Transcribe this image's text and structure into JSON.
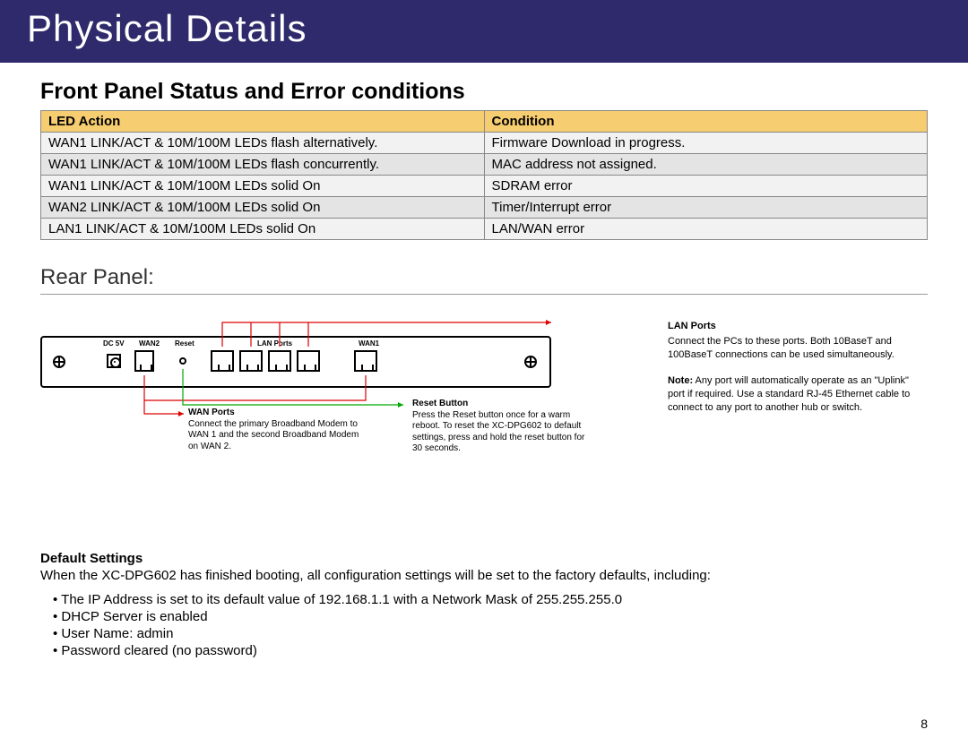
{
  "header": {
    "title": "Physical Details"
  },
  "section1": {
    "title": "Front Panel Status and Error conditions",
    "headers": [
      "LED Action",
      "Condition"
    ],
    "rows": [
      [
        "WAN1 LINK/ACT & 10M/100M LEDs flash alternatively.",
        "Firmware Download in progress."
      ],
      [
        "WAN1 LINK/ACT & 10M/100M LEDs flash concurrently.",
        "MAC address not assigned."
      ],
      [
        "WAN1 LINK/ACT & 10M/100M LEDs solid On",
        "SDRAM error"
      ],
      [
        "WAN2 LINK/ACT & 10M/100M LEDs solid On",
        "Timer/Interrupt error"
      ],
      [
        "LAN1 LINK/ACT & 10M/100M LEDs solid On",
        "LAN/WAN error"
      ]
    ]
  },
  "section2": {
    "title": "Rear Panel:"
  },
  "panel_labels": {
    "dc5v": "DC 5V",
    "wan2": "WAN2",
    "reset": "Reset",
    "lan": "LAN Ports",
    "wan1": "WAN1"
  },
  "callouts": {
    "wan": {
      "title": "WAN Ports",
      "body": "Connect the primary Broadband Modem to WAN 1 and the second Broadband Modem on WAN 2."
    },
    "reset": {
      "title": "Reset Button",
      "body": "Press the Reset button once for a warm reboot.  To reset the XC-DPG602 to default settings, press and hold the reset button for 30 seconds."
    },
    "lan": {
      "title": "LAN Ports",
      "body": "Connect the PCs to these ports. Both 10BaseT and 100BaseT connections can be used simultaneously.",
      "note_label": "Note:",
      "note": " Any port will automatically operate as an \"Uplink\" port if required. Use a standard RJ-45 Ethernet cable to connect to any port to another hub or switch."
    }
  },
  "defaults": {
    "heading": "Default Settings",
    "intro": "When the XC-DPG602 has finished booting, all configuration settings will be set to the factory defaults, including:",
    "items": [
      "The IP Address is set to its default value of 192.168.1.1 with a Network Mask of 255.255.255.0",
      "DHCP Server is enabled",
      "User Name: admin",
      "Password cleared (no password)"
    ]
  },
  "page": "8"
}
